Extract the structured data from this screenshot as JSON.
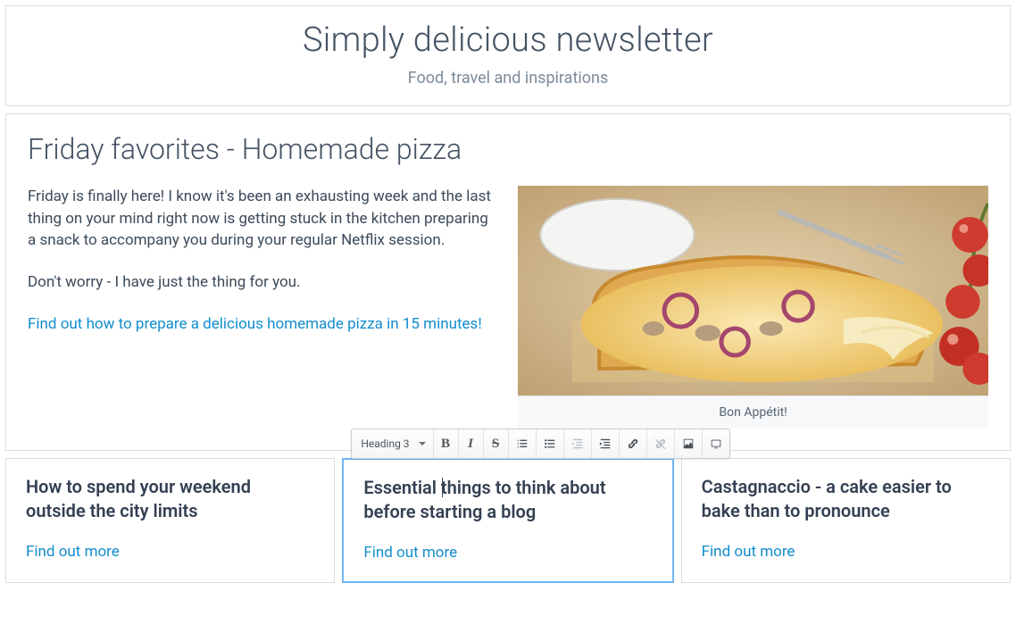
{
  "header": {
    "title": "Simply delicious newsletter",
    "subtitle": "Food, travel and inspirations"
  },
  "article": {
    "title": "Friday favorites - Homemade pizza",
    "p1": "Friday is finally here! I know it's been an exhausting week and the last thing on your mind right now is getting stuck in the kitchen preparing a snack to accompany you during your regular Netflix session.",
    "p2": "Don't worry - I have just the thing for you.",
    "link_text": "Find out how to prepare a delicious homemade pizza in 15 minutes!",
    "caption": "Bon Appétit!"
  },
  "toolbar": {
    "heading_label": "Heading 3",
    "bold_glyph": "B",
    "italic_glyph": "I",
    "strike_glyph": "S"
  },
  "cards": [
    {
      "title": "How to spend your weekend outside the city limits",
      "more": "Find out more"
    },
    {
      "title": "Essential things to think about before starting a blog",
      "more": "Find out more"
    },
    {
      "title": "Castagnaccio - a cake easier to bake than to pronounce",
      "more": "Find out more"
    }
  ],
  "colors": {
    "link": "#128dcd",
    "active_border": "#6fb6f2",
    "heading_text": "#445264"
  }
}
